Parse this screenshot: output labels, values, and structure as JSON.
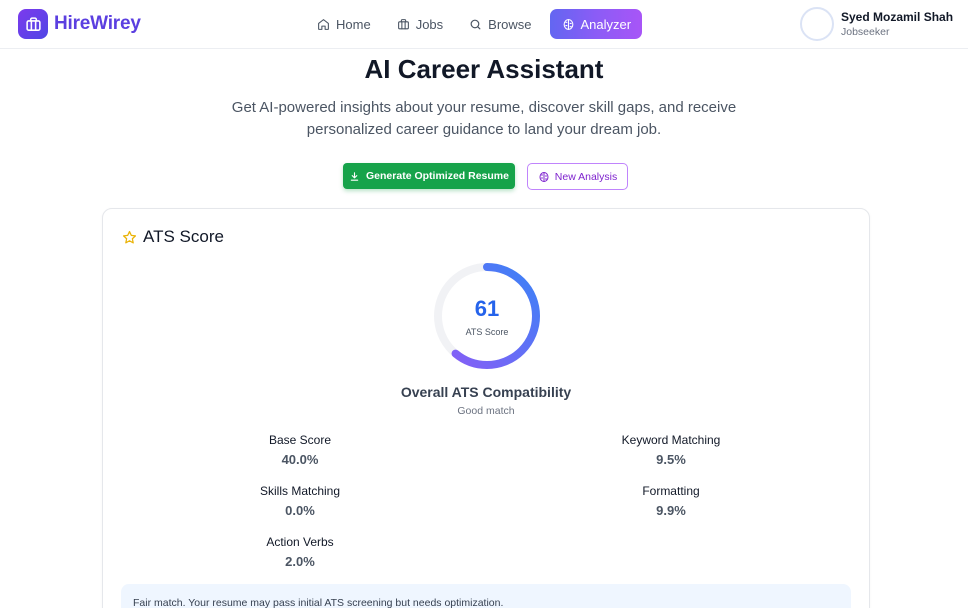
{
  "brand": {
    "name": "HireWirey"
  },
  "nav": {
    "home": "Home",
    "jobs": "Jobs",
    "browse": "Browse",
    "analyzer": "Analyzer"
  },
  "user": {
    "name": "Syed Mozamil Shah",
    "role": "Jobseeker"
  },
  "hero": {
    "title": "AI Career Assistant",
    "subtitle": "Get AI-powered insights about your resume, discover skill gaps, and receive personalized career guidance to land your dream job."
  },
  "actions": {
    "generate": "Generate Optimized Resume",
    "new_analysis": "New Analysis"
  },
  "ats": {
    "title": "ATS Score",
    "score": 61,
    "score_text": "61",
    "score_label": "ATS Score",
    "overall_title": "Overall ATS Compatibility",
    "overall_sub": "Good match",
    "metrics": {
      "base": {
        "label": "Base Score",
        "value": "40.0%"
      },
      "keyword": {
        "label": "Keyword Matching",
        "value": "9.5%"
      },
      "skills": {
        "label": "Skills Matching",
        "value": "0.0%"
      },
      "formatting": {
        "label": "Formatting",
        "value": "9.9%"
      },
      "verbs": {
        "label": "Action Verbs",
        "value": "2.0%"
      }
    },
    "note": "Fair match. Your resume may pass initial ATS screening but needs optimization."
  },
  "colors": {
    "brand": "#5b3fe0",
    "score": "#2563eb",
    "green": "#16a34a",
    "purple": "#7e22ce",
    "star": "#eab308"
  },
  "icons": {
    "logo": "briefcase-icon",
    "home": "home-icon",
    "jobs": "briefcase-icon",
    "browse": "search-icon",
    "analyzer": "brain-icon",
    "generate": "download-icon",
    "new_analysis": "brain-icon",
    "ats": "star-icon"
  }
}
